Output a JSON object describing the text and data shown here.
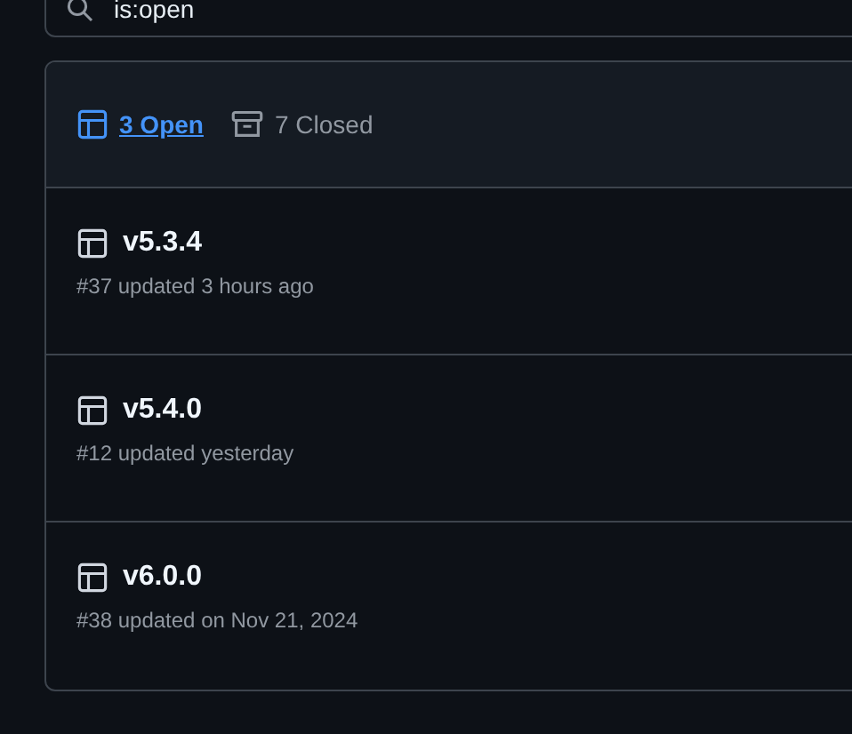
{
  "search": {
    "value": "is:open"
  },
  "tabs": [
    {
      "kind": "open",
      "label": "3 Open",
      "selected": true
    },
    {
      "kind": "closed",
      "label": "7 Closed",
      "selected": false
    }
  ],
  "milestones": [
    {
      "title": "v5.3.4",
      "meta": "#37 updated 3 hours ago"
    },
    {
      "title": "v5.4.0",
      "meta": "#12 updated yesterday"
    },
    {
      "title": "v6.0.0",
      "meta": "#38 updated on Nov 21, 2024"
    }
  ]
}
